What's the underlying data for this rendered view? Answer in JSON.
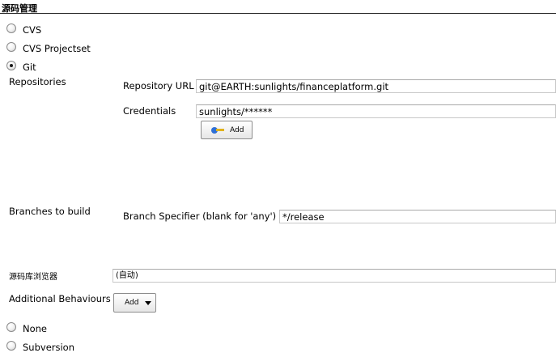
{
  "section": {
    "title": "源码管理"
  },
  "scm_options": [
    {
      "label": "CVS",
      "selected": false
    },
    {
      "label": "CVS Projectset",
      "selected": false
    },
    {
      "label": "Git",
      "selected": true
    }
  ],
  "git": {
    "repositories_label": "Repositories",
    "repository_url_label": "Repository URL",
    "repository_url_value": "git@EARTH:sunlights/financeplatform.git",
    "credentials_label": "Credentials",
    "credentials_value": "sunlights/******",
    "add_credentials_label": "Add",
    "branches_label": "Branches to build",
    "branch_specifier_label": "Branch Specifier (blank for 'any')",
    "branch_specifier_value": "*/release",
    "repo_browser_label": "源码库浏览器",
    "repo_browser_value": "(自动)",
    "additional_behaviours_label": "Additional Behaviours",
    "add_behaviour_label": "Add"
  },
  "other_options": [
    {
      "label": "None",
      "selected": false
    },
    {
      "label": "Subversion",
      "selected": false
    }
  ],
  "icons": {
    "credentials_add": "key-icon",
    "behaviour_add": "caret-down-icon"
  }
}
